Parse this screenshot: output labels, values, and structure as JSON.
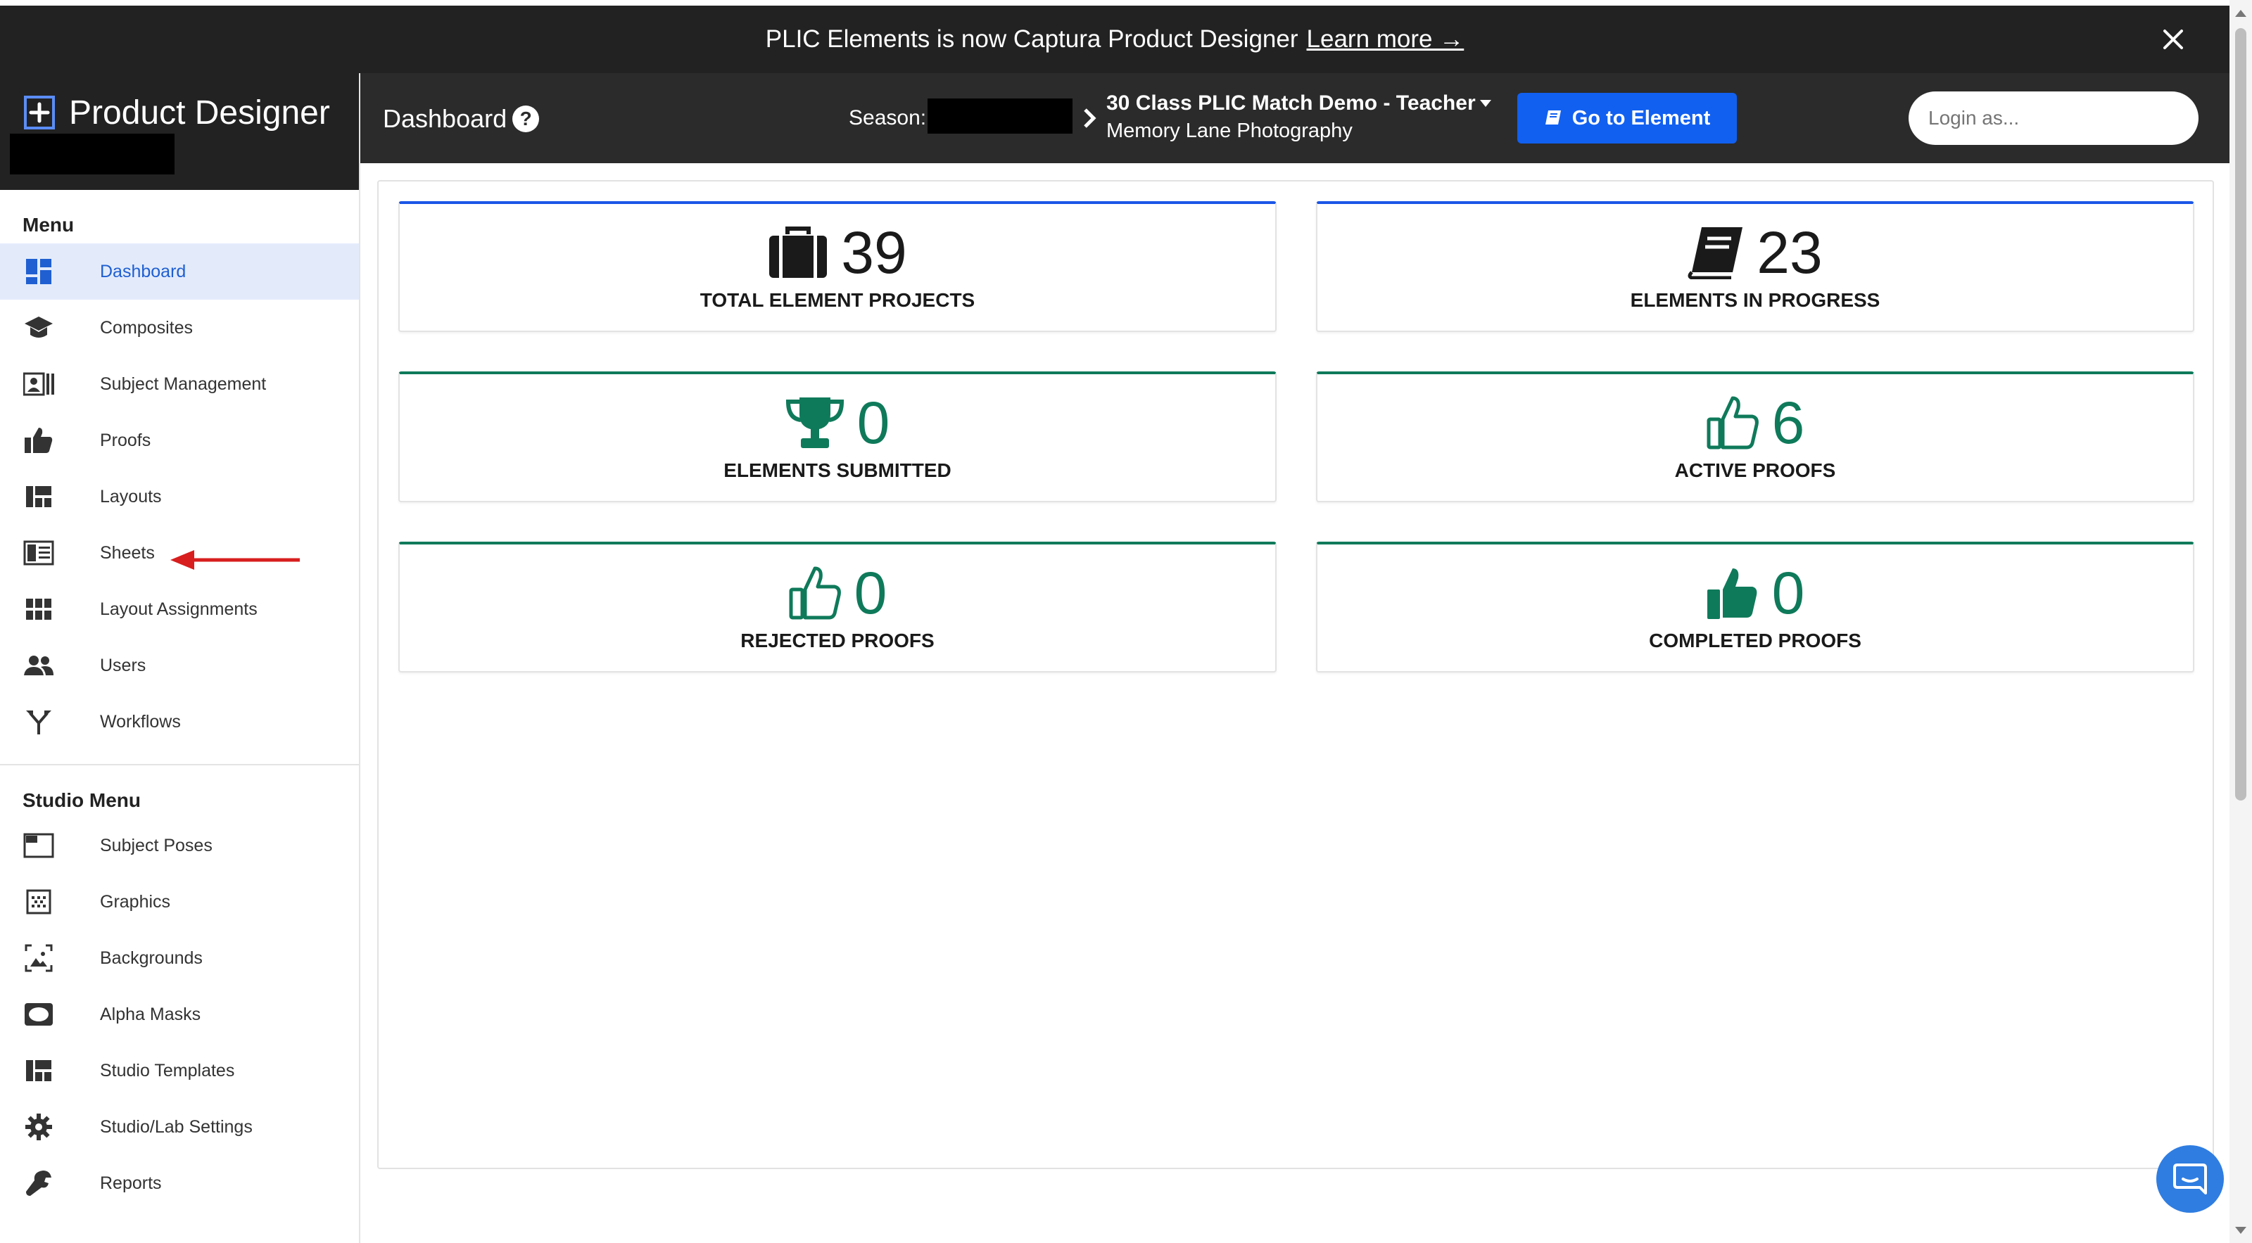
{
  "banner": {
    "text": "PLIC Elements is now Captura Product Designer",
    "link": "Learn more →"
  },
  "brand": {
    "name": "Product Designer"
  },
  "menu": {
    "heading": "Menu",
    "items": [
      {
        "label": "Dashboard"
      },
      {
        "label": "Composites"
      },
      {
        "label": "Subject Management"
      },
      {
        "label": "Proofs"
      },
      {
        "label": "Layouts"
      },
      {
        "label": "Sheets"
      },
      {
        "label": "Layout Assignments"
      },
      {
        "label": "Users"
      },
      {
        "label": "Workflows"
      }
    ]
  },
  "studio_menu": {
    "heading": "Studio Menu",
    "items": [
      {
        "label": "Subject Poses"
      },
      {
        "label": "Graphics"
      },
      {
        "label": "Backgrounds"
      },
      {
        "label": "Alpha Masks"
      },
      {
        "label": "Studio Templates"
      },
      {
        "label": "Studio/Lab Settings"
      },
      {
        "label": "Reports"
      }
    ]
  },
  "header": {
    "title": "Dashboard",
    "season_label": "Season:",
    "project_name": "30 Class PLIC Match Demo - Teacher",
    "studio_name": "Memory Lane Photography",
    "go_button": "Go to Element",
    "login_placeholder": "Login as..."
  },
  "stats": [
    {
      "value": "39",
      "label": "TOTAL ELEMENT PROJECTS",
      "icon": "briefcase-icon",
      "color": "#1a1a1a"
    },
    {
      "value": "23",
      "label": "ELEMENTS IN PROGRESS",
      "icon": "book-icon",
      "color": "#1a1a1a"
    },
    {
      "value": "0",
      "label": "ELEMENTS SUBMITTED",
      "icon": "trophy-icon",
      "color": "#0f7a5a"
    },
    {
      "value": "6",
      "label": "ACTIVE PROOFS",
      "icon": "thumbs-up-outline-icon",
      "color": "#0f7a5a"
    },
    {
      "value": "0",
      "label": "REJECTED PROOFS",
      "icon": "thumbs-up-outline-icon",
      "color": "#0f7a5a"
    },
    {
      "value": "0",
      "label": "COMPLETED PROOFS",
      "icon": "thumbs-up-solid-icon",
      "color": "#0f7a5a"
    }
  ],
  "colors": {
    "accent_blue": "#1160f0",
    "active_menu_bg": "#e3ebfb",
    "stat_green": "#0f7a5a",
    "header_bg": "#2b2b2b",
    "annotation_arrow": "#d81e1e"
  }
}
